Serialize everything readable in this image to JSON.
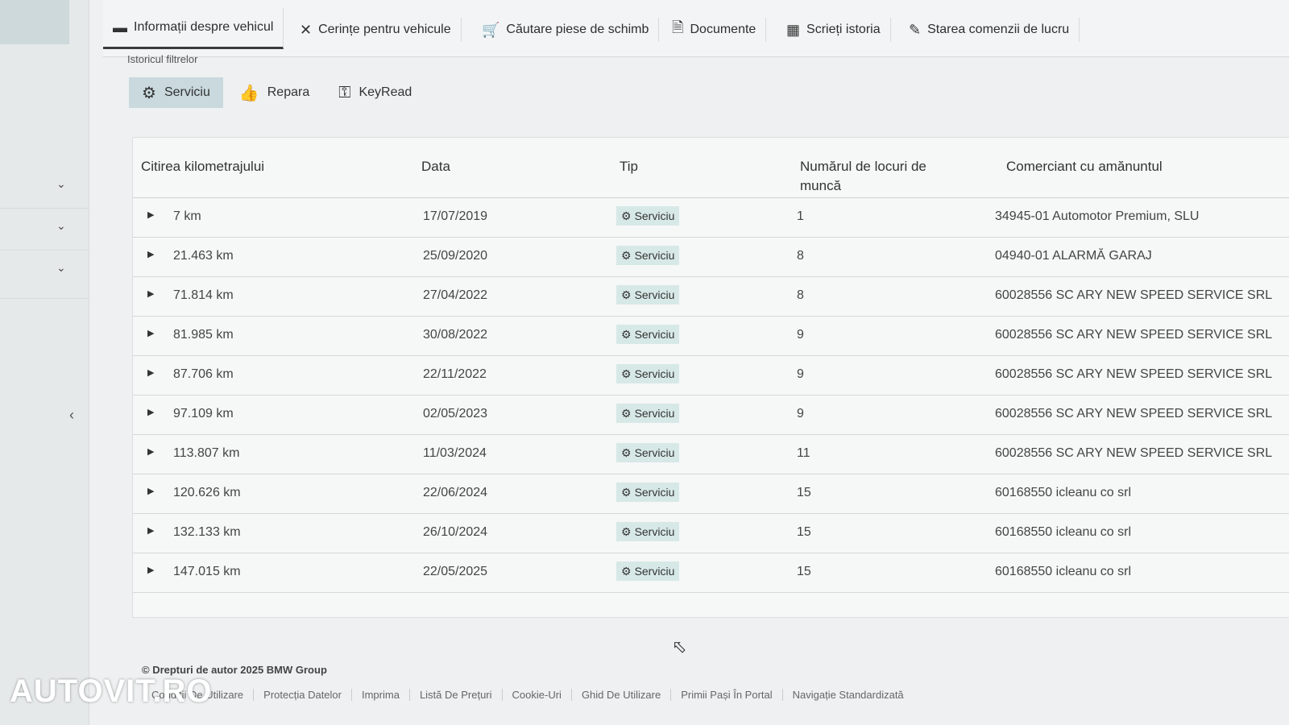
{
  "tabs": [
    {
      "label": "Informații despre vehicul",
      "icon": "car-icon"
    },
    {
      "label": "Cerințe pentru vehicule",
      "icon": "tools-icon"
    },
    {
      "label": "Căutare piese de schimb",
      "icon": "cart-icon"
    },
    {
      "label": "Documente",
      "icon": "document-icon"
    },
    {
      "label": "Scrieți istoria",
      "icon": "calendar-icon"
    },
    {
      "label": "Starea comenzii de lucru",
      "icon": "edit-icon"
    }
  ],
  "filter_caption": "Istoricul filtrelor",
  "filters": [
    {
      "label": "Serviciu",
      "icon": "gear-icon"
    },
    {
      "label": "Repara",
      "icon": "thumbs-up-icon"
    },
    {
      "label": "KeyRead",
      "icon": "key-icon"
    }
  ],
  "table": {
    "headers": [
      "Citirea kilometrajului",
      "Data",
      "Tip",
      "Numărul de locuri de muncă",
      "Comerciant cu amănuntul"
    ],
    "rows": [
      {
        "km": "7 km",
        "date": "17/07/2019",
        "type": "Serviciu",
        "jobs": "1",
        "dealer": "34945-01 Automotor Premium, SLU"
      },
      {
        "km": "21.463 km",
        "date": "25/09/2020",
        "type": "Serviciu",
        "jobs": "8",
        "dealer": "04940-01 ALARMĂ GARAJ"
      },
      {
        "km": "71.814 km",
        "date": "27/04/2022",
        "type": "Serviciu",
        "jobs": "8",
        "dealer": "60028556 SC ARY NEW SPEED SERVICE SRL"
      },
      {
        "km": "81.985 km",
        "date": "30/08/2022",
        "type": "Serviciu",
        "jobs": "9",
        "dealer": "60028556 SC ARY NEW SPEED SERVICE SRL"
      },
      {
        "km": "87.706 km",
        "date": "22/11/2022",
        "type": "Serviciu",
        "jobs": "9",
        "dealer": "60028556 SC ARY NEW SPEED SERVICE SRL"
      },
      {
        "km": "97.109 km",
        "date": "02/05/2023",
        "type": "Serviciu",
        "jobs": "9",
        "dealer": "60028556 SC ARY NEW SPEED SERVICE SRL"
      },
      {
        "km": "113.807 km",
        "date": "11/03/2024",
        "type": "Serviciu",
        "jobs": "11",
        "dealer": "60028556 SC ARY NEW SPEED SERVICE SRL"
      },
      {
        "km": "120.626 km",
        "date": "22/06/2024",
        "type": "Serviciu",
        "jobs": "15",
        "dealer": "60168550 icleanu co srl"
      },
      {
        "km": "132.133 km",
        "date": "26/10/2024",
        "type": "Serviciu",
        "jobs": "15",
        "dealer": "60168550 icleanu co srl"
      },
      {
        "km": "147.015 km",
        "date": "22/05/2025",
        "type": "Serviciu",
        "jobs": "15",
        "dealer": "60168550 icleanu co srl"
      }
    ]
  },
  "copyright": "© Drepturi de autor 2025 BMW Group",
  "footer_links": [
    "Condiții De Utilizare",
    "Protecția Datelor",
    "Imprima",
    "Listă De Prețuri",
    "Cookie-Uri",
    "Ghid De Utilizare",
    "Primii Pași În Portal",
    "Navigație Standardizată"
  ],
  "watermark": "AUTOVIT.RO"
}
